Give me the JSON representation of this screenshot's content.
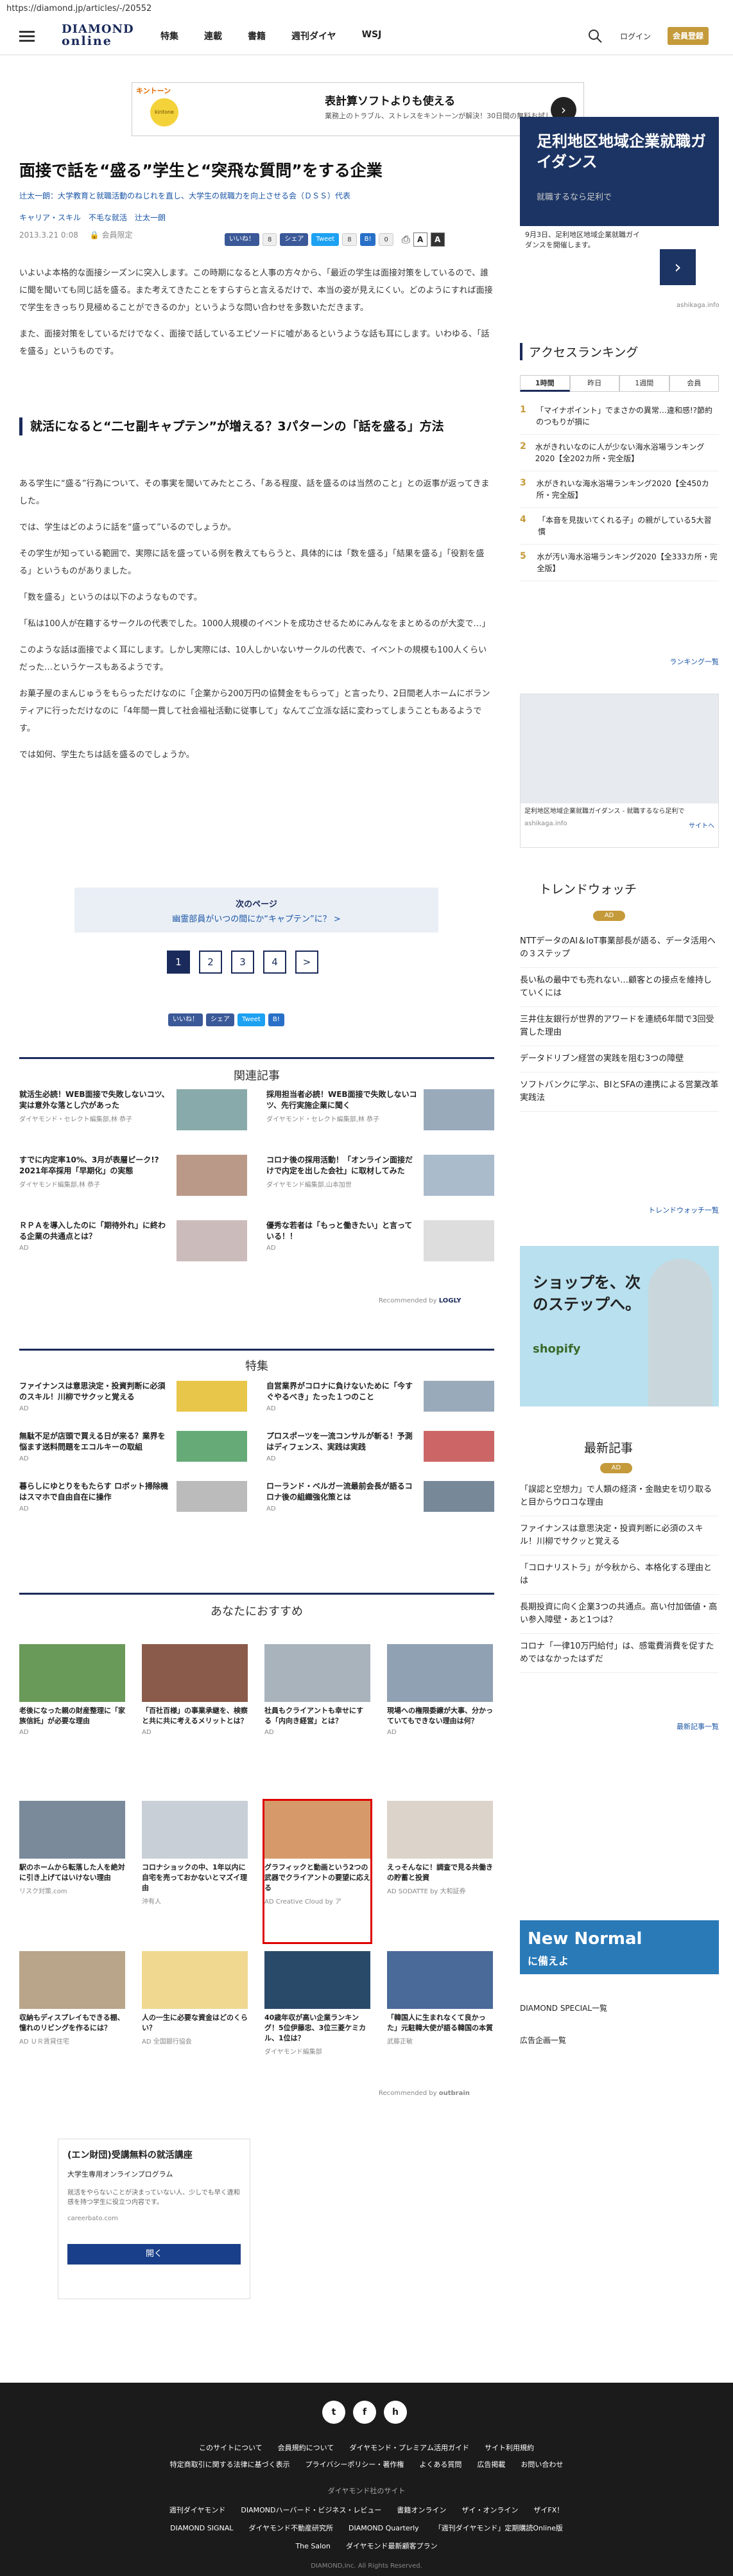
{
  "url": "https://diamond.jp/articles/-/20552",
  "header": {
    "logo_line1": "DIAMOND",
    "logo_line2": "online",
    "nav": [
      "特集",
      "連載",
      "書籍",
      "週刊ダイヤ",
      "WSJ"
    ],
    "login": "ログイン",
    "member": "会員登録"
  },
  "top_ad": {
    "brand": "キントーン",
    "logo_text": "kintone",
    "title": "表計算ソフトよりも使える",
    "text": "業務上のトラブル、ストレスをキントーンが解決！30日間の無料お試し",
    "arrow": "›"
  },
  "article": {
    "title": "面接で話を“盛る”学生と“突飛な質問”をする企業",
    "sub": "辻太一朗：大学教育と就職活動のねじれを直し、大学生の就職力を向上させる会（ＤＳＳ）代表",
    "tags": "キャリア・スキル　不毛な就活　辻太一朗",
    "date": "2013.3.21 0:08",
    "member_only": "会員限定",
    "share": {
      "like": "いいね！",
      "count_like": "8",
      "share": "シェア",
      "tweet": "Tweet",
      "count_tweet": "8",
      "hatena": "B!",
      "count_hatena": "0"
    },
    "p1": "いよいよ本格的な面接シーズンに突入します。この時期になると人事の方々から、「最近の学生は面接対策をしているので、誰に聞を聞いても同じ話を盛る。また考えてきたことをすらすらと言えるだけで、本当の姿が見えにくい。どのようにすれば面接で学生をきっちり見極めることができるのか」というような問い合わせを多数いただきます。",
    "p2": "また、面接対策をしているだけでなく、面接で話しているエピソードに嘘があるというような話も耳にします。いわゆる、「話を盛る」というものです。",
    "subhead": "就活になると“二セ副キャプテン”が増える？3パターンの「話を盛る」方法",
    "p3": "ある学生に“盛る”行為について、その事実を聞いてみたところ、「ある程度、話を盛るのは当然のこと」との返事が返ってきました。",
    "p4": "では、学生はどのように話を“盛って”いるのでしょうか。",
    "p5": "その学生が知っている範囲で、実際に話を盛っている例を教えてもらうと、具体的には「数を盛る」「結果を盛る」「役割を盛る」というものがありました。",
    "p6": "「数を盛る」というのは以下のようなものです。",
    "p7": "「私は100人が在籍するサークルの代表でした。1000人規模のイベントを成功させるためにみんなをまとめるのが大変で…」",
    "p8": "このような話は面接でよく耳にします。しかし実際には、10人しかいないサークルの代表で、イベントの規模も100人くらいだった…というケースもあるようです。",
    "p9": "お菓子屋のまんじゅうをもらっただけなのに「企業から200万円の協賛金をもらって」と言ったり、2日間老人ホームにボランティアに行っただけなのに「4年間一貫して社会福祉活動に従事して」なんてご立派な話に変わってしまうこともあるようです。",
    "p10": "では如何、学生たちは話を盛るのでしょうか。"
  },
  "next": {
    "label": "次のページ",
    "title": "幽霊部員がいつの間にか“キャプテン”に？ >"
  },
  "pager": [
    "1",
    "2",
    "3",
    "4",
    ">"
  ],
  "related": {
    "heading": "関連記事",
    "items": [
      {
        "title": "就活生必読！WEB面接で失敗しないコツ、実は意外な落とし穴があった",
        "src": "ダイヤモンド・セレクト編集部,林 恭子"
      },
      {
        "title": "採用担当者必読！WEB面接で失敗しないコツ、先行実施企業に聞く",
        "src": "ダイヤモンド・セレクト編集部,林 恭子"
      },
      {
        "title": "すでに内定率10%、3月が表層ピーク!? 2021年卒採用「早期化」の実態",
        "src": "ダイヤモンド編集部,林 恭子"
      },
      {
        "title": "コロナ後の採用活動！「オンライン面接だけで内定を出した会社」に取材してみた",
        "src": "ダイヤモンド編集部,山本加世"
      },
      {
        "title": "ＲＰＡを導入したのに「期待外れ」に終わる企業の共通点とは？",
        "src": "AD"
      },
      {
        "title": "優秀な若者は「もっと働きたい」と言っている！！",
        "src": "AD"
      }
    ],
    "recommended": "Recommended by",
    "logly": "LOGLY"
  },
  "special": {
    "heading": "特集",
    "items": [
      {
        "title": "ファイナンスは意思決定・投資判断に必須のスキル！川柳でサクッと覚える",
        "src": "AD"
      },
      {
        "title": "自営業界がコロナに負けないために「今すぐやるべき」たった１つのこと",
        "src": "AD"
      },
      {
        "title": "無駄不足が店頭で買える日が来る？業界を悩ます送料問題をエコルキーの取組",
        "src": "AD"
      },
      {
        "title": "プロスポーツを一流コンサルが斬る！予測はディフェンス、実践は実践",
        "src": "AD"
      },
      {
        "title": "暮らしにゆとりをもたらす ロボット掃除機はスマホで自由自在に操作",
        "src": "AD"
      },
      {
        "title": "ローランド・ベルガー流最前会長が語るコロナ後の組織強化策とは",
        "src": "AD"
      }
    ]
  },
  "osusume": {
    "heading": "あなたにおすすめ",
    "items": [
      {
        "title": "老後になった親の財産整理に「家族信託」が必要な理由",
        "src": "AD"
      },
      {
        "title": "「百社百様」の事業承継を、検察と共に共に考えるメリットとは？",
        "src": "AD"
      },
      {
        "title": "社員もクライアントも幸せにする「内向き経営」とは？",
        "src": "AD"
      },
      {
        "title": "現場への権限委譲が大事、分かっていてもできない理由は何？",
        "src": "AD"
      },
      {
        "title": "駅のホームから転落した人を絶対に引き上げてはいけない理由",
        "src": "リスク対策.com"
      },
      {
        "title": "コロナショックの中、1年以内に自宅を売っておかないとマズイ理由",
        "src": "沖有人"
      },
      {
        "title": "グラフィックと動画という2つの武器でクライアントの要望に応える",
        "src": "AD Creative Cloud by ア"
      },
      {
        "title": "えっそんなに！調査で見る共働きの貯蓄と投資",
        "src": "AD SODATTE by 大和証券"
      },
      {
        "title": "収納もディスプレイもできる棚、憧れのリビングを作るには？",
        "src": "AD ＵＲ賃貸住宅"
      },
      {
        "title": "人の一生に必要な資金はどのくらい？",
        "src": "AD 全国銀行協会"
      },
      {
        "title": "40歳年収が高い企業ランキング！5位伊藤忠、3位三菱ケミカル、1位は？",
        "src": "ダイヤモンド編集部"
      },
      {
        "title": "「韓国人に生まれなくて良かった」元駐韓大使が語る韓国の本質",
        "src": "武藤正敏"
      }
    ],
    "recommended": "Recommended by",
    "outbrain": "outbrain"
  },
  "bottom_ad": {
    "title": "(エン財団)受講無料の就活講座",
    "sub": "大学生専用オンラインプログラム",
    "text": "就活をやらないことが決まっていない人、少しでも早く違和感を持つ学生に役立つ内容です。",
    "src": "careerbato.com",
    "btn": "開く"
  },
  "sidebar": {
    "ad": {
      "title": "足利地区地域企業就職ガイダンス",
      "text": "就職するなら足利で",
      "sub": "9月3日、足利地区地域企業就職ガイダンスを開催します。",
      "arrow": "›",
      "src": "ashikaga.info"
    },
    "ranking_heading": "アクセスランキング",
    "tabs": [
      "1時間",
      "昨日",
      "1週間",
      "会員"
    ],
    "ranking": [
      {
        "n": "1",
        "t": "「マイナポイント」でまさかの異常…違和感!?節約のつもりが損に"
      },
      {
        "n": "2",
        "t": "水がきれいなのに人が少ない海水浴場ランキング2020【全202カ所・完全版】"
      },
      {
        "n": "3",
        "t": "水がきれいな海水浴場ランキング2020【全450カ所・完全版】"
      },
      {
        "n": "4",
        "t": "「本音を見抜いてくれる子」の親がしている5大習慣"
      },
      {
        "n": "5",
        "t": "水が汚い海水浴場ランキング2020【全333カ所・完全版】"
      }
    ],
    "ranking_more": "ランキング一覧",
    "ad2_caption": "足利地区地域企業就職ガイダンス - 就職するなら足利で",
    "ad2_src": "ashikaga.info",
    "ad2_link": "サイトへ",
    "trend_heading": "トレンドウォッチ",
    "trend_badge": "AD",
    "trend": [
      "NTTデータのAI＆IoT事業部長が語る、データ活用への３ステップ",
      "長い私の最中でも売れない…顧客との接点を維持していくには",
      "三井住友銀行が世界的アワードを連続6年間で3回受賞した理由",
      "データドリブン経営の実践を阻む3つの障壁",
      "ソフトバンクに学ぶ、BIとSFAの連携による営業改革実践法"
    ],
    "trend_more": "トレンドウォッチ一覧",
    "shopify_text": "ショップを、次のステップへ。",
    "shopify_brand": "shopify",
    "latest_heading": "最新記事",
    "latest_badge": "AD",
    "latest": [
      "「誤認と空想力」で人類の経済・金融史を切り取ると目からウロコな理由",
      "ファイナンスは意思決定・投資判断に必須のスキル！川柳でサクッと覚える",
      "「コロナリストラ」が今秋から、本格化する理由とは",
      "長期投資に向く企業3つの共通点。高い付加価値・高い参入障壁・あと1つは？",
      "コロナ「一律10万円給付」は、感電費消費を促すためではなかったはずだ"
    ],
    "latest_more": "最新記事一覧",
    "newnormal": "New Normal",
    "newnormal_sub": "に備えよ",
    "ds_link": "DIAMOND SPECIAL一覧",
    "ad_link": "広告企画一覧"
  },
  "footer": {
    "social": [
      "t",
      "f",
      "h"
    ],
    "nav1": [
      "このサイトについて",
      "会員規約について",
      "ダイヤモンド・プレミアム活用ガイド",
      "サイト利用規約"
    ],
    "nav2": [
      "特定商取引に関する法律に基づく表示",
      "プライバシーポリシー・著作権",
      "よくある質問",
      "広告掲載",
      "お問い合わせ"
    ],
    "group_heading": "ダイヤモンド社のサイト",
    "group1": [
      "週刊ダイヤモンド",
      "DIAMONDハーバード・ビジネス・レビュー",
      "書籍オンライン",
      "ザイ・オンライン",
      "ザイFX！"
    ],
    "group2": [
      "DIAMOND SIGNAL",
      "ダイヤモンド不動産研究所",
      "DIAMOND Quarterly",
      "「週刊ダイヤモンド」定期購読Online版"
    ],
    "group3": [
      "The Salon",
      "ダイヤモンド最新顧客プラン"
    ],
    "copyright": "DIAMOND,Inc. All Rights Reserved."
  }
}
